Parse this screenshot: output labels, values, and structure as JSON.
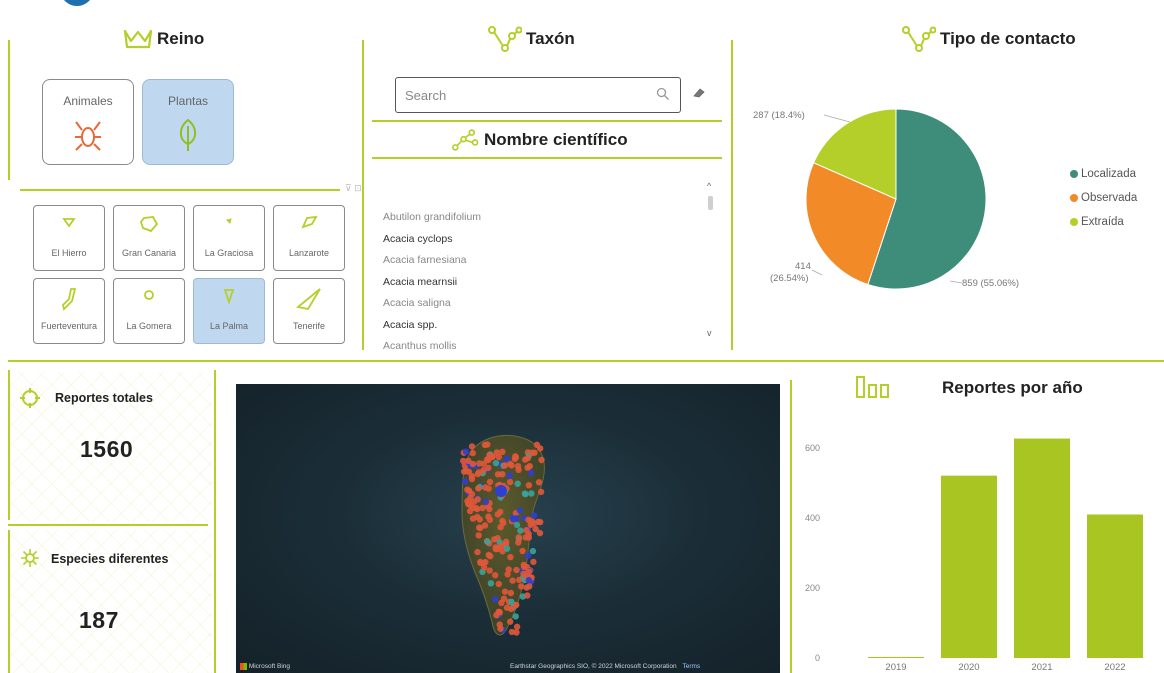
{
  "colors": {
    "accent": "#b5cf2a",
    "selected": "#bfd7ef",
    "localizada": "#3e8c7a",
    "observada": "#f28a28",
    "extraida": "#b5cf2a",
    "bar": "#a8c522",
    "animal_icon": "#e46a3a"
  },
  "reino": {
    "title": "Reino",
    "icon": "crown-icon",
    "buttons": [
      {
        "label": "Animales",
        "icon": "beetle-icon",
        "selected": false
      },
      {
        "label": "Plantas",
        "icon": "leaf-icon",
        "selected": true
      }
    ]
  },
  "islands": [
    {
      "label": "El Hierro",
      "icon": "el-hierro-icon",
      "selected": false
    },
    {
      "label": "Gran Canaria",
      "icon": "gran-canaria-icon",
      "selected": false
    },
    {
      "label": "La Graciosa",
      "icon": "la-graciosa-icon",
      "selected": false
    },
    {
      "label": "Lanzarote",
      "icon": "lanzarote-icon",
      "selected": false
    },
    {
      "label": "Fuerteventura",
      "icon": "fuerteventura-icon",
      "selected": false
    },
    {
      "label": "La Gomera",
      "icon": "la-gomera-icon",
      "selected": false
    },
    {
      "label": "La Palma",
      "icon": "la-palma-icon",
      "selected": true
    },
    {
      "label": "Tenerife",
      "icon": "tenerife-icon",
      "selected": false
    }
  ],
  "taxon": {
    "title": "Taxón",
    "icon": "branch-icon",
    "search_placeholder": "Search",
    "search_icon": "search-icon",
    "eraser_icon": "eraser-icon"
  },
  "nombre_cientifico": {
    "title": "Nombre científico",
    "icon": "branch-icon",
    "items": [
      {
        "name": "Abutilon grandifolium",
        "dim": true
      },
      {
        "name": "Acacia cyclops",
        "dim": false
      },
      {
        "name": "Acacia farnesiana",
        "dim": true
      },
      {
        "name": "Acacia mearnsii",
        "dim": false
      },
      {
        "name": "Acacia saligna",
        "dim": true
      },
      {
        "name": "Acacia spp.",
        "dim": false
      },
      {
        "name": "Acanthus mollis",
        "dim": true
      }
    ]
  },
  "tipo_contacto": {
    "title": "Tipo de contacto",
    "icon": "branch-icon",
    "chart_data": {
      "type": "pie",
      "slices": [
        {
          "name": "Localizada",
          "value": 859,
          "percent": "55.06%"
        },
        {
          "name": "Observada",
          "value": 414,
          "percent": "26.54%"
        },
        {
          "name": "Extraída",
          "value": 287,
          "percent": "18.4%"
        }
      ],
      "labels": [
        "287 (18.4%)",
        "414",
        "(26.54%)",
        "859 (55.06%)"
      ],
      "legend_position": "right"
    }
  },
  "kpis": [
    {
      "title": "Reportes totales",
      "value": "1560",
      "icon": "target-icon"
    },
    {
      "title": "Especies diferentes",
      "value": "187",
      "icon": "virus-icon"
    }
  ],
  "map": {
    "attribution_left": "Microsoft Bing",
    "attribution_right": "Earthstar Geographics SIO, © 2022 Microsoft Corporation",
    "terms": "Terms",
    "marker_colors": [
      "#e0583a",
      "#2f3fd0",
      "#3aa39a"
    ]
  },
  "reportes_por_anio": {
    "title": "Reportes por año",
    "icon": "bar-chart-icon",
    "chart_data": {
      "type": "bar",
      "categories": [
        "2019",
        "2020",
        "2021",
        "2022"
      ],
      "values": [
        3,
        521,
        627,
        410
      ],
      "yticks": [
        0,
        200,
        400,
        600
      ],
      "ylim": [
        0,
        680
      ],
      "grid": false
    }
  }
}
